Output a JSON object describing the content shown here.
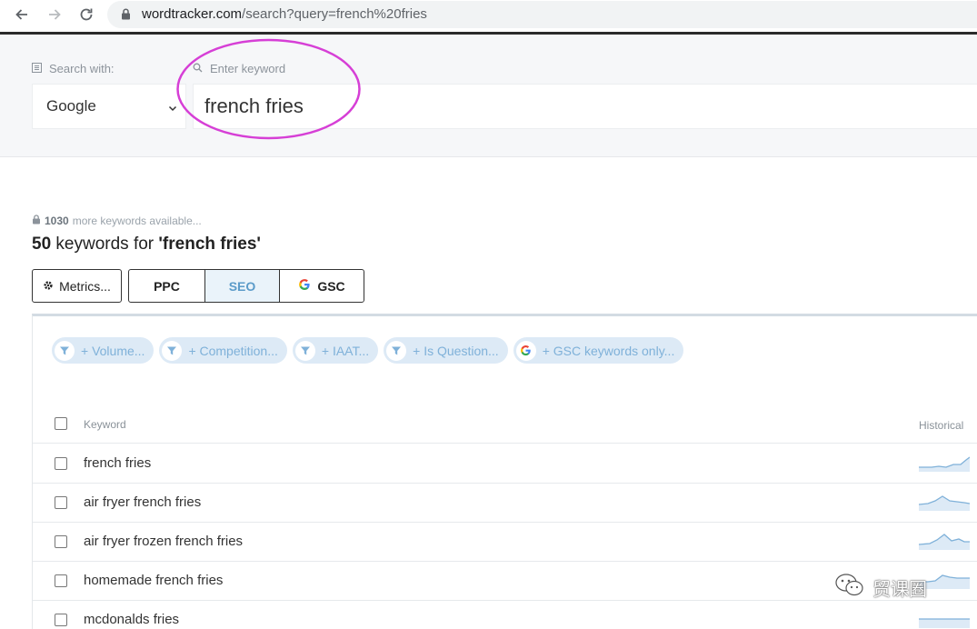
{
  "browser": {
    "url_host": "wordtracker.com",
    "url_path": "/search?query=french%20fries",
    "icons": [
      "back-arrow-icon",
      "forward-arrow-icon",
      "reload-icon",
      "lock-icon"
    ]
  },
  "search": {
    "search_with_label": "Search with:",
    "keyword_label": "Enter keyword",
    "engine": "Google",
    "keyword_value": "french fries",
    "annotation_color": "#d63fd6"
  },
  "results": {
    "more_count": "1030",
    "more_text": "more keywords available...",
    "count": "50",
    "title_middle": "keywords for",
    "query_quoted": "'french fries'"
  },
  "toolbar": {
    "metrics_label": "Metrics...",
    "ppc_label": "PPC",
    "seo_label": "SEO",
    "gsc_label": "GSC",
    "active_tab": "SEO"
  },
  "filters": [
    {
      "label": "+ Volume...",
      "icon": "filter-icon"
    },
    {
      "label": "+ Competition...",
      "icon": "filter-icon"
    },
    {
      "label": "+ IAAT...",
      "icon": "filter-icon"
    },
    {
      "label": "+ Is Question...",
      "icon": "filter-icon"
    },
    {
      "label": "+ GSC keywords only...",
      "icon": "google-icon"
    }
  ],
  "table": {
    "col_keyword": "Keyword",
    "col_historical": "Historical",
    "rows": [
      {
        "keyword": "french fries"
      },
      {
        "keyword": "air fryer french fries"
      },
      {
        "keyword": "air fryer frozen french fries"
      },
      {
        "keyword": "homemade french fries"
      },
      {
        "keyword": "mcdonalds fries"
      }
    ]
  },
  "watermark": {
    "text": "贸课圈"
  },
  "colors": {
    "accent_blue": "#5b9bc9",
    "chip_bg": "#ddeaf6",
    "spark": "#7fb1d9"
  }
}
